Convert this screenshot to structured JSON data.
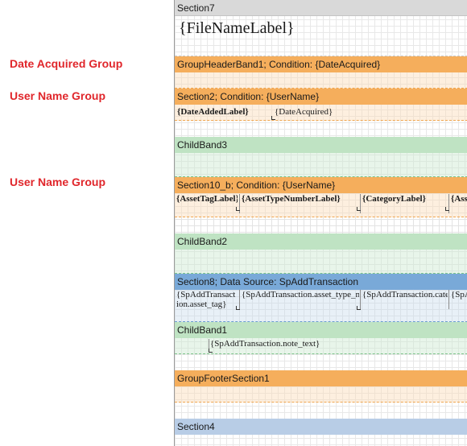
{
  "annotations": {
    "date_acquired_group": "Date Acquired Group",
    "user_name_group_1": "User Name Group",
    "user_name_group_2": "User Name Group"
  },
  "bands": {
    "section7": "Section7",
    "group_header_band1": "GroupHeaderBand1; Condition: {DateAcquired}",
    "section2": "Section2; Condition: {UserName}",
    "child_band3": "ChildBand3",
    "section10b": "Section10_b; Condition: {UserName}",
    "child_band2": "ChildBand2",
    "section8": "Section8; Data Source: SpAddTransaction",
    "child_band1": "ChildBand1",
    "group_footer_section1": "GroupFooterSection1",
    "section4": "Section4"
  },
  "fields": {
    "file_name_label": "{FileNameLabel}",
    "date_added_label": "{DateAddedLabel}",
    "date_acquired": "{DateAcquired}",
    "asset_tag_label": "{AssetTagLabel}",
    "asset_type_number_label": "{AssetTypeNumberLabel}",
    "category_label": "{CategoryLabel}",
    "asset_partial_label": "{AssetLabel}",
    "sp_asset_tag": "{SpAddTransaction.asset_tag}",
    "sp_asset_type_number": "{SpAddTransaction.asset_type_number}",
    "sp_category": "{SpAddTransaction.category}",
    "sp_asset": "{SpAddTransaction.asset}",
    "sp_note_text": "{SpAddTransaction.note_text}"
  }
}
